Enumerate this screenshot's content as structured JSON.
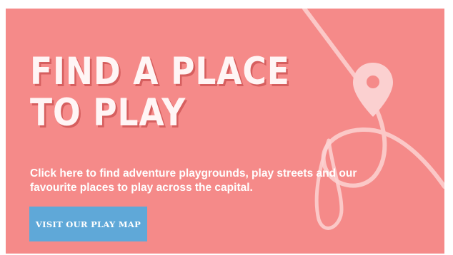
{
  "banner": {
    "headline_line1": "FIND A PLACE",
    "headline_line2": "TO PLAY",
    "description": "Click here to find adventure playgrounds, play streets and our favourite places to play across the capital.",
    "cta_label": "VISIT OUR PLAY MAP",
    "background_color": "#f58a89",
    "cta_color": "#5fa8d8",
    "icons": [
      "map-pin-icon",
      "trail-path-icon"
    ]
  }
}
